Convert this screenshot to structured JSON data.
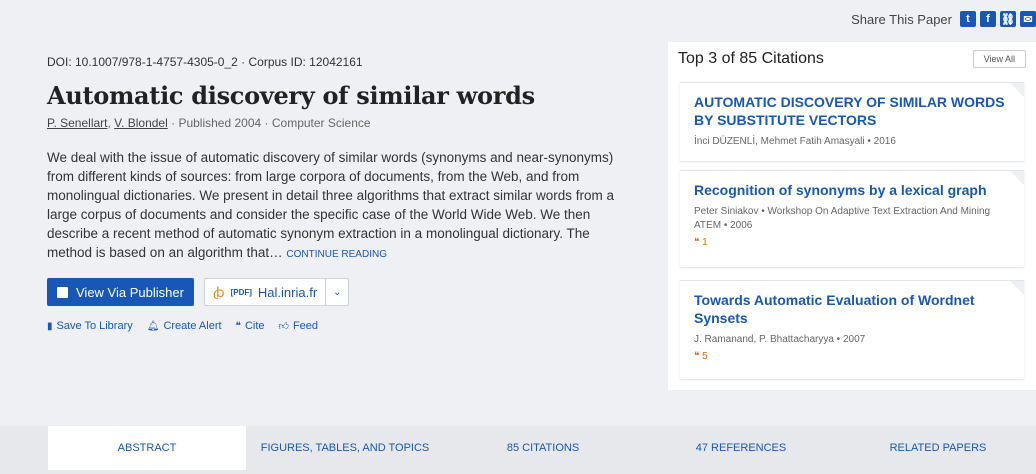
{
  "share": {
    "label": "Share This Paper",
    "icons": [
      "twitter-icon",
      "facebook-icon",
      "link-icon",
      "mail-icon"
    ]
  },
  "paper": {
    "doi": "DOI: 10.1007/978-1-4757-4305-0_2",
    "corpus": "Corpus ID: 12042161",
    "title": "Automatic discovery of similar words",
    "authors": [
      "P. Senellart",
      "V. Blondel"
    ],
    "published": "Published 2004",
    "field": "Computer Science",
    "abstract": "We deal with the issue of automatic discovery of similar words (synonyms and near-synonyms) from different kinds of sources: from large corpora of documents, from the Web, and from monolingual dictionaries. We present in detail three algorithms that extract similar words from a large corpus of documents and consider the specific case of the World Wide Web. We then describe a recent method of automatic synonym extraction in a monolingual dictionary. The method is based on an algorithm that…",
    "continue": "CONTINUE READING"
  },
  "actions": {
    "view_publisher": "View Via Publisher",
    "pdf_tag": "[PDF]",
    "pdf_source": "Hal.inria.fr",
    "save": "Save To Library",
    "alert": "Create Alert",
    "cite": "Cite",
    "feed": "Feed"
  },
  "citations": {
    "header": "Top 3 of 85 Citations",
    "view_all": "View All",
    "items": [
      {
        "title": "AUTOMATIC DISCOVERY OF SIMILAR WORDS BY SUBSTITUTE VECTORS",
        "meta": "İnci DÜZENLİ, Mehmet Fatih Amasyali  •  2016",
        "count": ""
      },
      {
        "title": "Recognition of synonyms by a lexical graph",
        "meta": "Peter Siniakov  •  Workshop On Adaptive Text Extraction And Mining ATEM  •  2006",
        "count": "1"
      },
      {
        "title": "Towards Automatic Evaluation of Wordnet Synsets",
        "meta": "J. Ramanand, P. Bhattacharyya  •  2007",
        "count": "5"
      }
    ]
  },
  "tabs": [
    "ABSTRACT",
    "FIGURES, TABLES, AND TOPICS",
    "85 CITATIONS",
    "47 REFERENCES",
    "RELATED PAPERS"
  ]
}
